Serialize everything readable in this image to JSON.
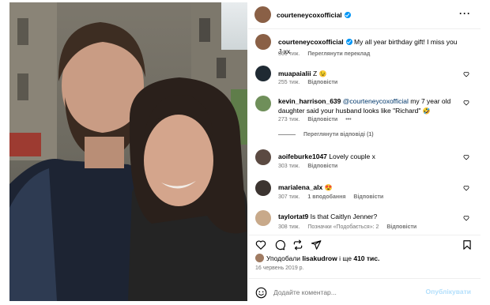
{
  "post": {
    "author": "courteneycoxofficial",
    "more_icon": "more-horizontal-icon",
    "caption": {
      "username": "courteneycoxofficial",
      "text": "My all year birthday gift! I miss you J xx",
      "time": "366 тиж.",
      "translate": "Переглянути переклад"
    }
  },
  "comments": [
    {
      "username": "muapaialii",
      "text": "Z",
      "emoji": "😉",
      "time": "255 тиж.",
      "reply": "Відповісти",
      "avatar_color": "#1f2a33"
    },
    {
      "username": "kevin_harrison_639",
      "mention": "@courteneycoxofficial",
      "text": " my 7 year old daughter said your husband looks like \"Richard\"",
      "emoji": "🤣",
      "time": "273 тиж.",
      "reply": "Відповісти",
      "more": "•••",
      "view_replies": "Переглянути відповіді (1)",
      "avatar_color": "#6f8f5a"
    },
    {
      "username": "aoifeburke1047",
      "text": "Lovely couple x",
      "time": "303 тиж.",
      "reply": "Відповісти",
      "avatar_color": "#5b4a42"
    },
    {
      "username": "marialena_alx",
      "text": "",
      "emoji": "😍",
      "time": "307 тиж.",
      "likes": "1 вподобання",
      "reply": "Відповісти",
      "avatar_color": "#3c3430"
    },
    {
      "username": "taylortat9",
      "text": "Is that Caitlyn Jenner?",
      "time": "308 тиж.",
      "tags": "Позначки «Подобається»: 2",
      "reply": "Відповісти",
      "avatar_color": "#c8a98a"
    }
  ],
  "actions": {
    "like_icon": "heart-icon",
    "comment_icon": "comment-icon",
    "share_icon": "send-icon",
    "save_icon": "bookmark-icon"
  },
  "likes": {
    "prefix": "Уподобали ",
    "user": "lisakudrow",
    "middle": " і ще ",
    "count": "410 тис."
  },
  "date": "16 червень 2019 р.",
  "add_comment": {
    "placeholder": "Додайте коментар...",
    "publish": "Опублікувати"
  },
  "colors": {
    "accent": "#0095f6",
    "publish_disabled": "#b2dffc",
    "meta": "#737373",
    "mention": "#00376b"
  }
}
